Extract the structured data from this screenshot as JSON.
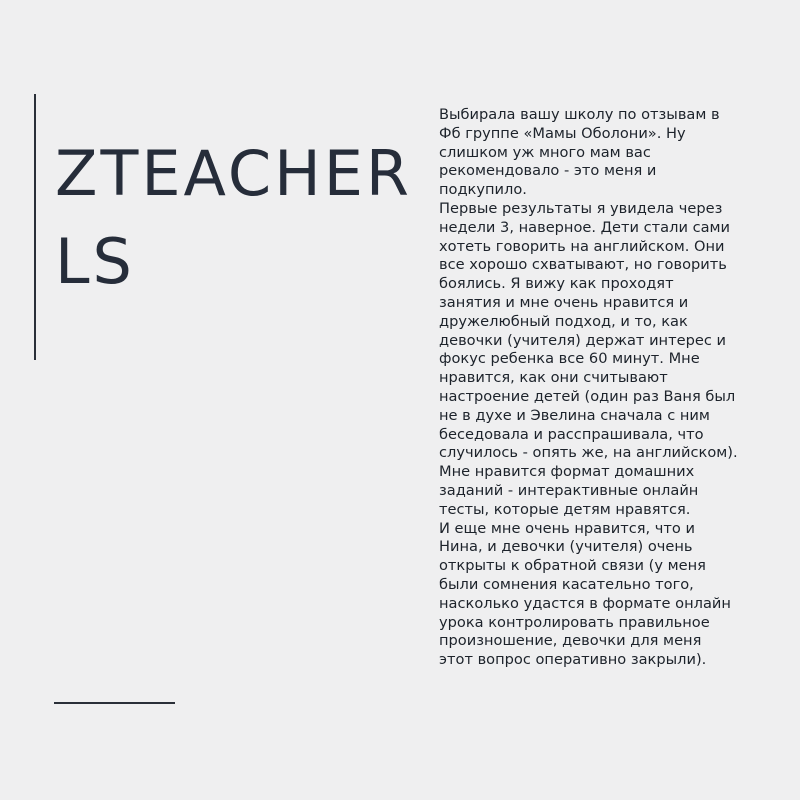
{
  "brand": {
    "line1": "ZTEACHER",
    "line2": "LS"
  },
  "testimonial": {
    "paragraphs": [
      "Выбирала вашу школу по отзывам в Фб группе «Мамы Оболони». Ну слишком уж много мам вас рекомендовало - это меня и подкупило.",
      "Первые результаты я увидела через недели 3, наверное. Дети стали сами хотеть говорить на английском. Они все хорошо схватывают, но говорить боялись. Я вижу как проходят занятия и мне очень нравится и дружелюбный подход, и то, как девочки (учителя) держат интерес и фокус ребенка все 60 минут. Мне нравится, как они считывают настроение детей (один раз Ваня был не в духе и Эвелина сначала с ним беседовала и расспрашивала, что случилось - опять же, на английском). Мне нравится формат домашних заданий - интерактивные онлайн тесты, которые детям нравятся.",
      "И еще мне очень нравится, что и Нина, и девочки (учителя) очень открыты к обратной связи (у меня были сомнения касательно того, насколько удастся в формате онлайн урока контролировать правильное произношение, девочки для меня этот вопрос оперативно закрыли)."
    ]
  }
}
